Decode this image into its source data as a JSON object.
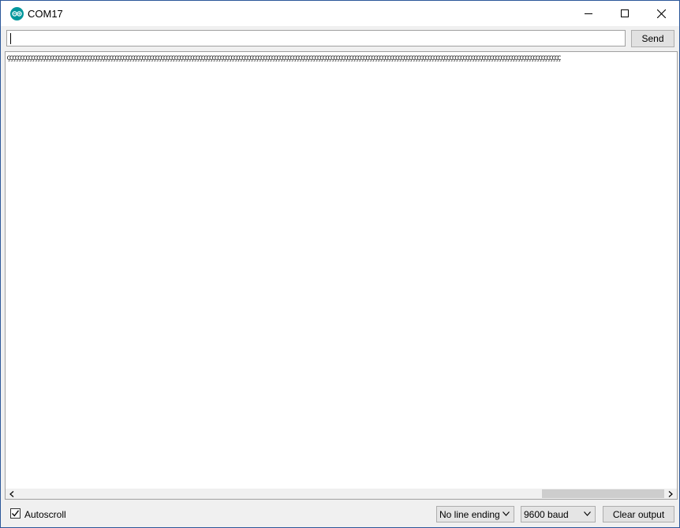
{
  "window": {
    "title": "COM17",
    "app_icon": "arduino-icon",
    "controls": [
      "minimize-icon",
      "maximize-icon",
      "close-icon"
    ]
  },
  "input": {
    "value": "",
    "send_label": "Send"
  },
  "output": {
    "text": "ççççççççççççççççççççççççççççççççççççççççççççççççççççççççççççççççççççççççççççççççççççççççççççççççççççççççççççççççççççççççççççççççççççççççççççççççççççççççççççççççççççççççççççççççççççççççççççççççççççççççççççç"
  },
  "footer": {
    "autoscroll_label": "Autoscroll",
    "autoscroll_checked": true,
    "line_ending": "No line ending",
    "baud": "9600 baud",
    "clear_label": "Clear output"
  },
  "colors": {
    "accent": "#00979c",
    "window_border": "#2b579a"
  }
}
